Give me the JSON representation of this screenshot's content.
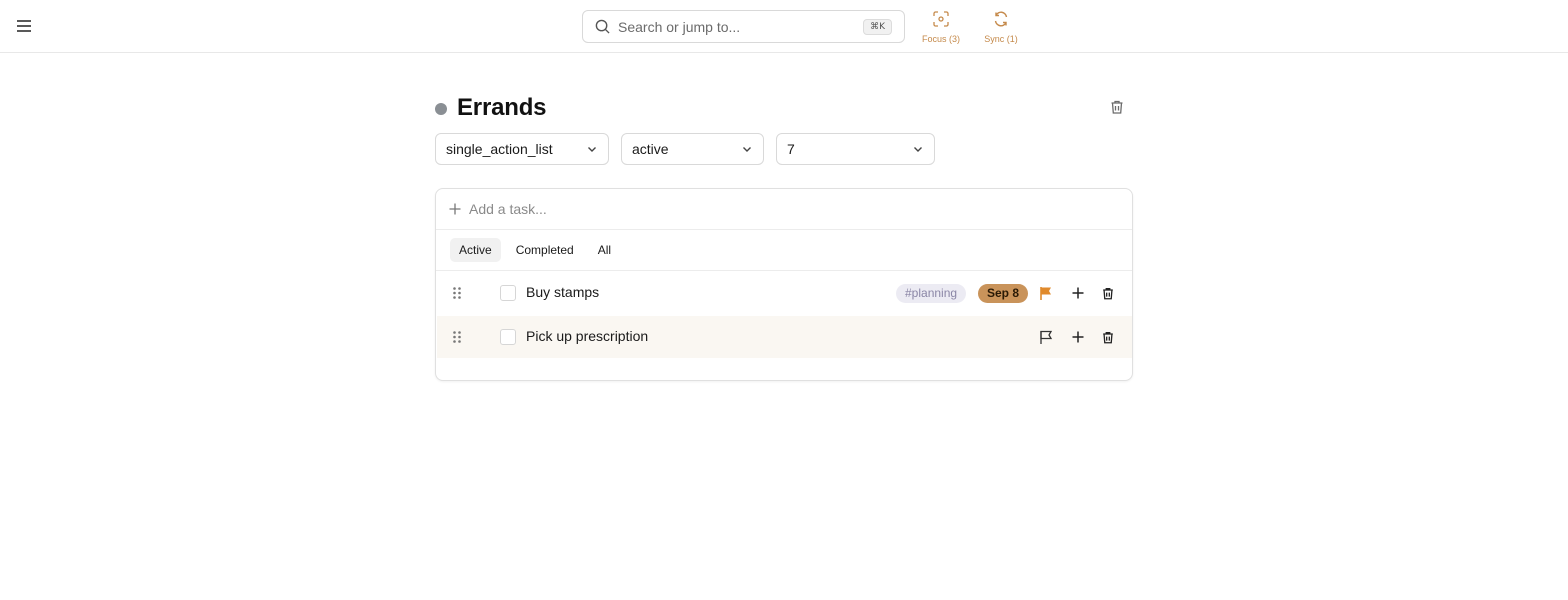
{
  "topbar": {
    "search_placeholder": "Search or jump to...",
    "search_shortcut": "⌘K",
    "focus_label": "Focus (3)",
    "sync_label": "Sync (1)"
  },
  "list": {
    "title": "Errands",
    "type": "single_action_list",
    "status": "active",
    "number": "7"
  },
  "composer": {
    "placeholder": "Add a task..."
  },
  "tabs": [
    {
      "label": "Active",
      "active": true
    },
    {
      "label": "Completed",
      "active": false
    },
    {
      "label": "All",
      "active": false
    }
  ],
  "tasks": [
    {
      "title": "Buy stamps",
      "tag": "#planning",
      "due": "Sep 8",
      "flagged": true
    },
    {
      "title": "Pick up prescription",
      "flagged": false
    }
  ],
  "colors": {
    "accent": "#c58a4b",
    "flag": "#e08a2c",
    "due_badge": "#c9935a",
    "tag_bg": "#ecebf3",
    "dot": "#8a8f94"
  }
}
